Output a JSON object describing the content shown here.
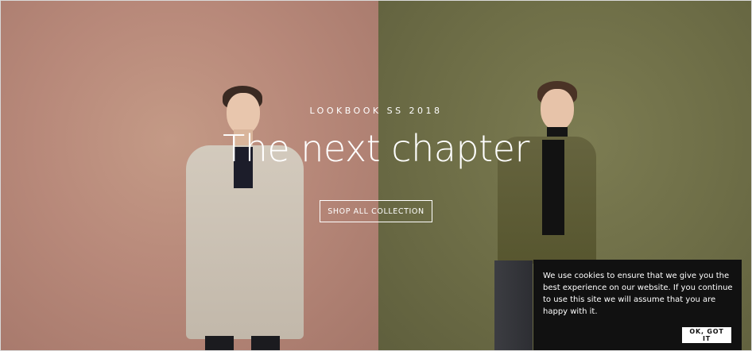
{
  "hero": {
    "eyebrow": "LOOKBOOK SS 2018",
    "headline": "The next chapter",
    "cta_label": "SHOP ALL COLLECTION",
    "left_panel_color": "#b8897a",
    "right_panel_color": "#6e6e47"
  },
  "models": [
    {
      "description_icon": "model-left-image",
      "coat_color": "#cfc6b9"
    },
    {
      "description_icon": "model-right-image",
      "coat_color": "#5f5e3a"
    }
  ],
  "cookie_notice": {
    "text": "We use cookies to ensure that we give you the best experience on our website. If you continue to use this site we will assume that you are happy with it.",
    "button_label": "OK, GOT IT",
    "background": "#111111"
  }
}
